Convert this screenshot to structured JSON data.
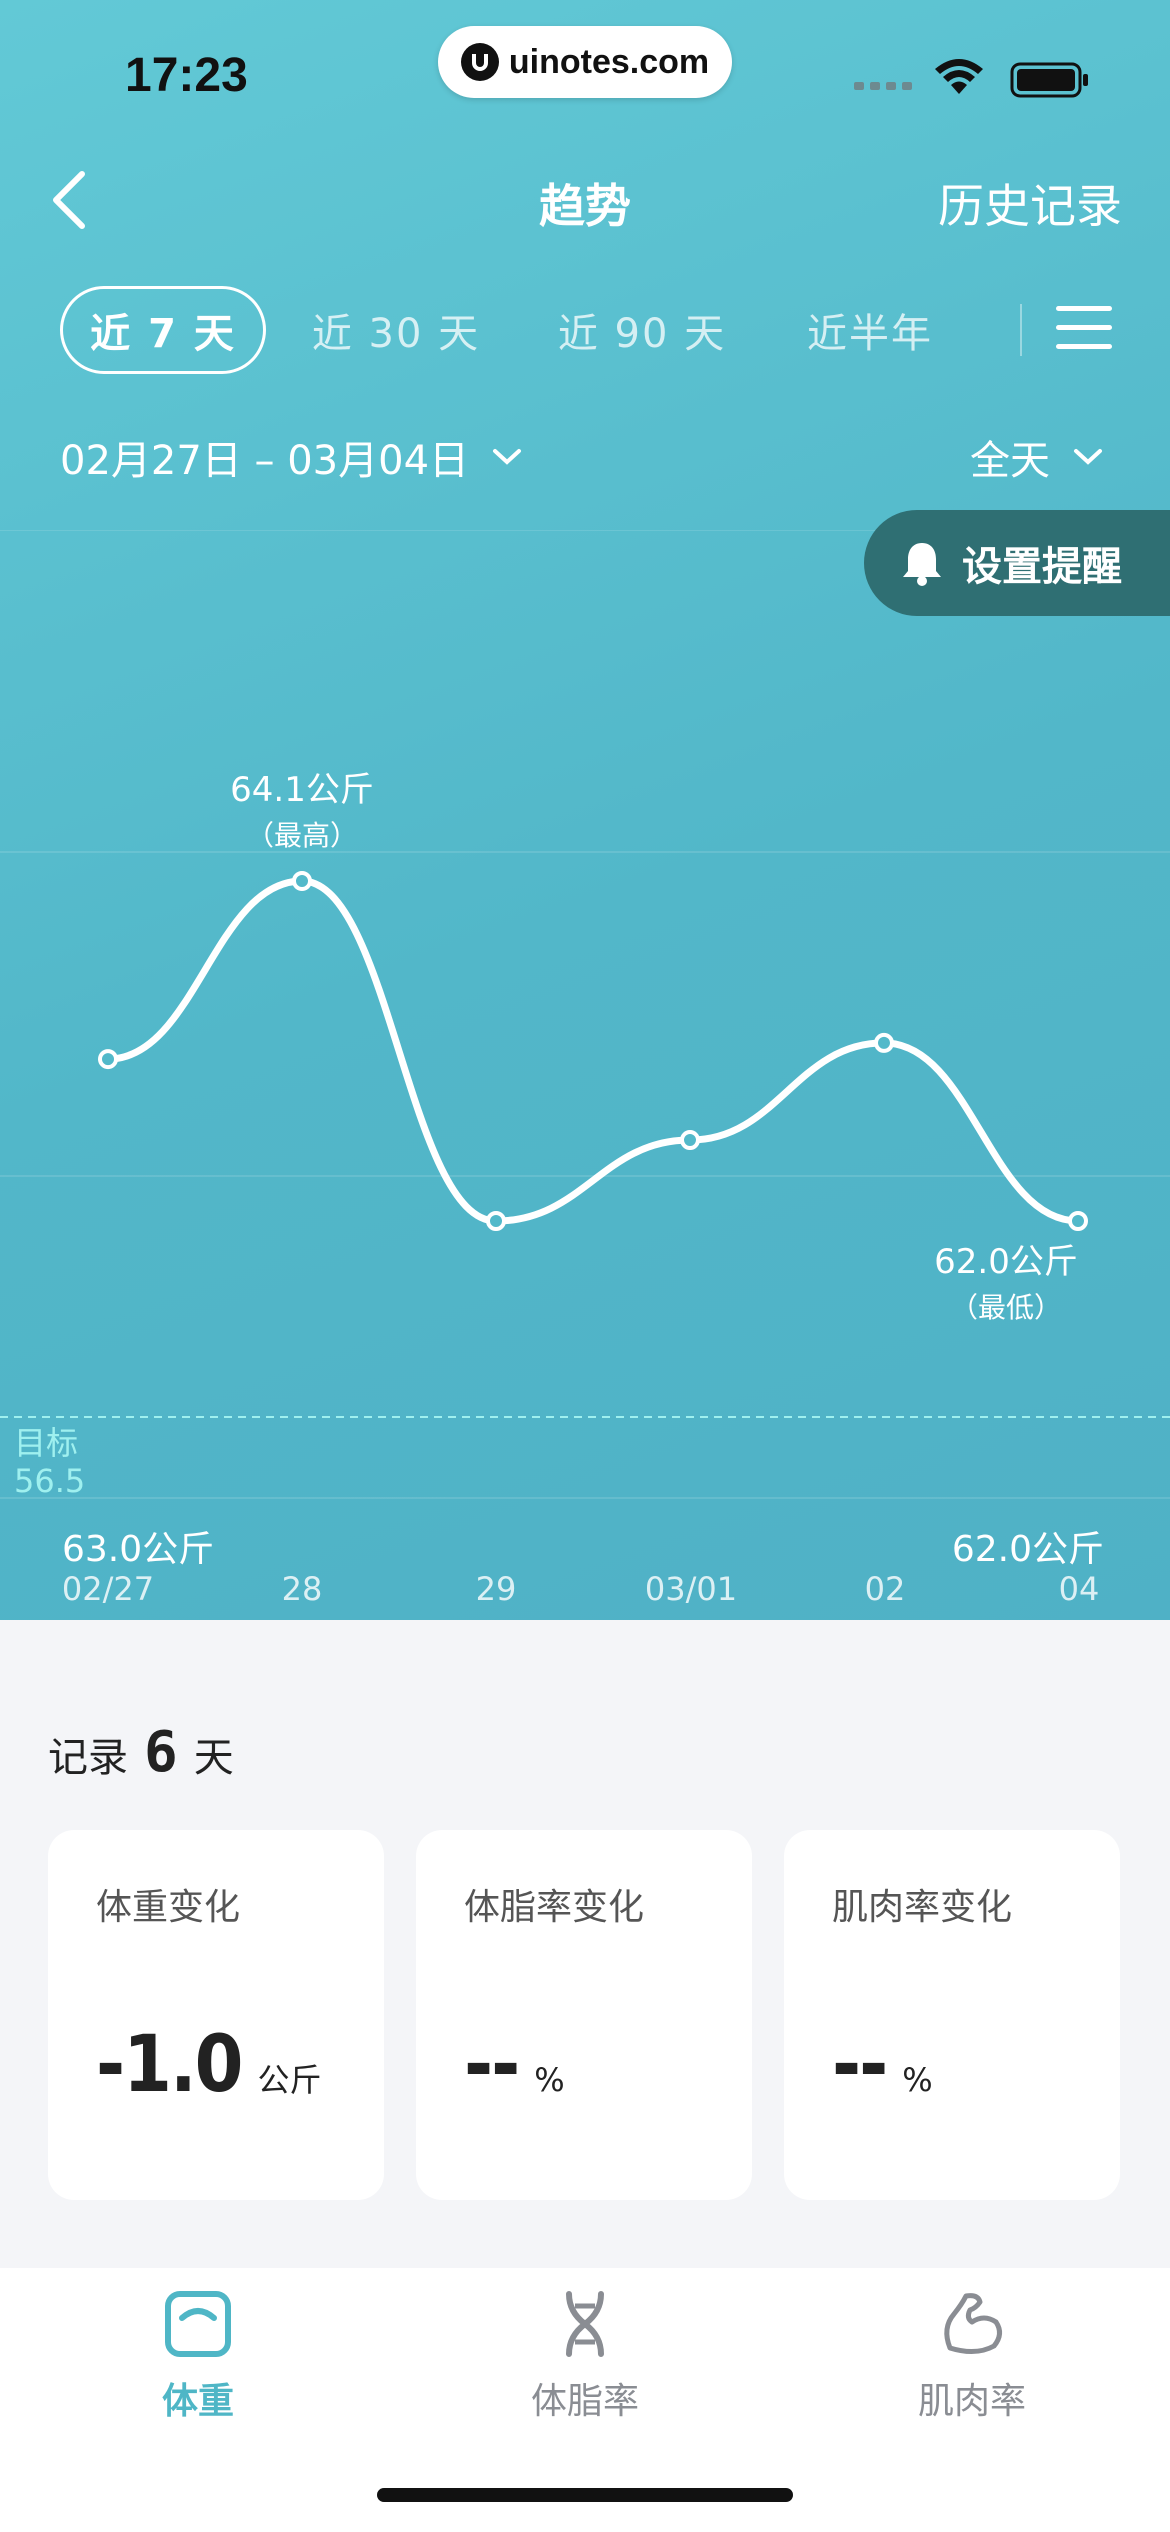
{
  "status": {
    "time": "17:23",
    "url": "uinotes.com"
  },
  "header": {
    "title": "趋势",
    "history": "历史记录"
  },
  "tabs": [
    {
      "label": "近 7 天",
      "active": true
    },
    {
      "label": "近 30 天",
      "active": false
    },
    {
      "label": "近 90 天",
      "active": false
    },
    {
      "label": "近半年",
      "active": false
    }
  ],
  "date_range": "02月27日 – 03月04日",
  "time_filter": "全天",
  "reminder": "设置提醒",
  "chart_data": {
    "type": "line",
    "unit": "公斤",
    "x": [
      "02/27",
      "28",
      "29",
      "03/01",
      "02",
      "04"
    ],
    "values": [
      63.0,
      64.1,
      62.0,
      62.5,
      63.1,
      62.0
    ],
    "max": {
      "label": "64.1公斤",
      "note": "（最高）"
    },
    "min": {
      "label": "62.0公斤",
      "note": "（最低）"
    },
    "goal": {
      "label": "目标",
      "value": "56.5"
    },
    "first_value": "63.0公斤",
    "last_value": "62.0公斤"
  },
  "records": {
    "prefix": "记录",
    "count": "6",
    "suffix": "天"
  },
  "cards": [
    {
      "title": "体重变化",
      "value": "-1.0",
      "unit": "公斤"
    },
    {
      "title": "体脂率变化",
      "value": "--",
      "unit": "%"
    },
    {
      "title": "肌肉率变化",
      "value": "--",
      "unit": "%"
    }
  ],
  "nav": [
    {
      "label": "体重",
      "icon": "scale-icon",
      "active": true
    },
    {
      "label": "体脂率",
      "icon": "dna-icon",
      "active": false
    },
    {
      "label": "肌肉率",
      "icon": "muscle-icon",
      "active": false
    }
  ],
  "colors": {
    "accent": "#4fb6c6",
    "reminder_bg": "#2f6f73",
    "goal": "#9ff0ef"
  }
}
